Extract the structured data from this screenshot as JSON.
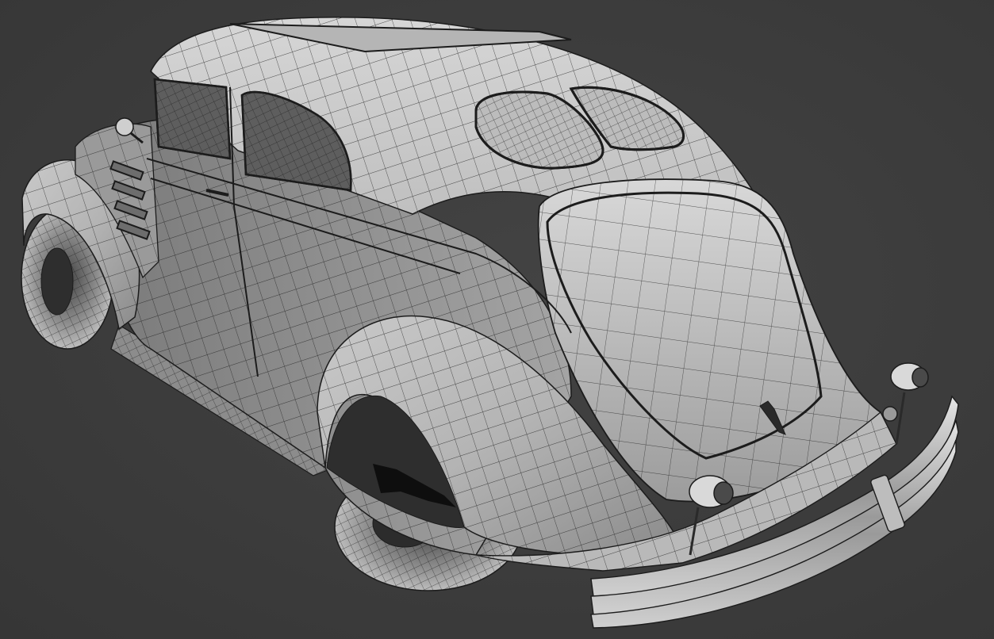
{
  "scene": {
    "subject_icon": "car-wireframe-icon",
    "colors": {
      "background": "#3a3a3a",
      "shading_light": "#d2d2d2",
      "shading_mid": "#a9a9a9",
      "shading_dark": "#6e6e6e",
      "glass": "#5e5e5e",
      "wire": "#1c1c1c"
    }
  }
}
